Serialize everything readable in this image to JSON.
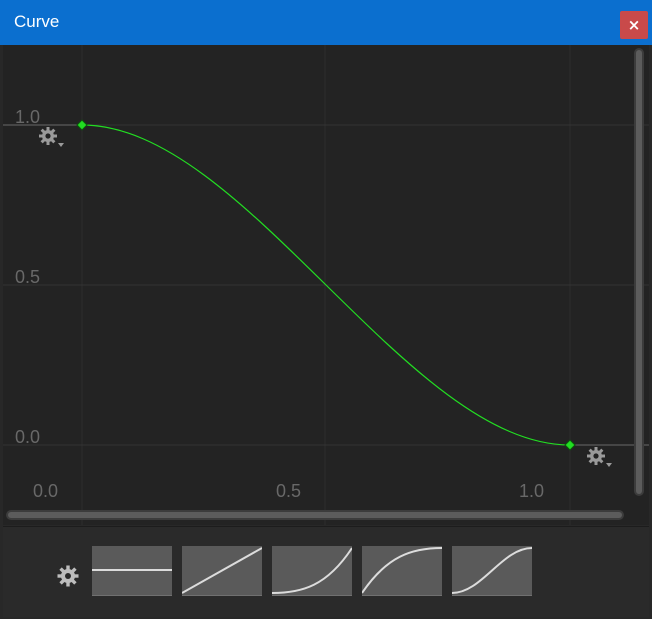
{
  "window": {
    "title": "Curve",
    "close_label": "×"
  },
  "axes": {
    "y_ticks": [
      "1.0",
      "0.5",
      "0.0"
    ],
    "x_ticks": [
      "0.0",
      "0.5",
      "1.0"
    ]
  },
  "curve": {
    "color": "#22dd22",
    "keys": [
      {
        "t": 0.0,
        "v": 1.0
      },
      {
        "t": 1.0,
        "v": 0.0
      }
    ],
    "shape": "ease-in-out"
  },
  "icons": {
    "key_settings": "gear-dropdown-icon",
    "presets_settings": "gear-icon"
  },
  "presets": [
    {
      "name": "constant",
      "icon": "preset-constant-icon"
    },
    {
      "name": "linear",
      "icon": "preset-linear-icon"
    },
    {
      "name": "ease-in",
      "icon": "preset-ease-in-icon"
    },
    {
      "name": "ease-out",
      "icon": "preset-ease-out-icon"
    },
    {
      "name": "ease-in-out",
      "icon": "preset-ease-in-out-icon"
    }
  ]
}
